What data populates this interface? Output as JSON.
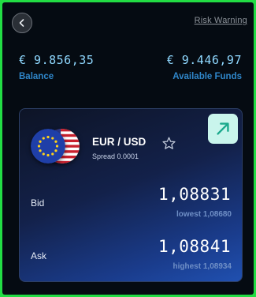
{
  "header": {
    "back_icon": "chevron-left-icon",
    "risk_warning_label": "Risk Warning"
  },
  "account": {
    "balance_value": "€ 9.856,35",
    "balance_label": "Balance",
    "available_value": "€ 9.446,97",
    "available_label": "Available Funds"
  },
  "instrument": {
    "pair": "EUR / USD",
    "spread": "Spread 0.0001",
    "flags": [
      "eu-flag-icon",
      "us-flag-icon"
    ],
    "favorite_icon": "star-outline-icon",
    "trend_icon": "arrow-up-right-icon"
  },
  "quotes": {
    "bid_label": "Bid",
    "bid_price": "1,08831",
    "bid_sub": "lowest 1,08680",
    "ask_label": "Ask",
    "ask_price": "1,08841",
    "ask_sub": "highest 1,08934"
  },
  "colors": {
    "frame": "#22dd44",
    "background": "#050b12",
    "amount": "#8fd8ff",
    "label": "#2f86c9",
    "accent_button": "#c9f5ec"
  }
}
